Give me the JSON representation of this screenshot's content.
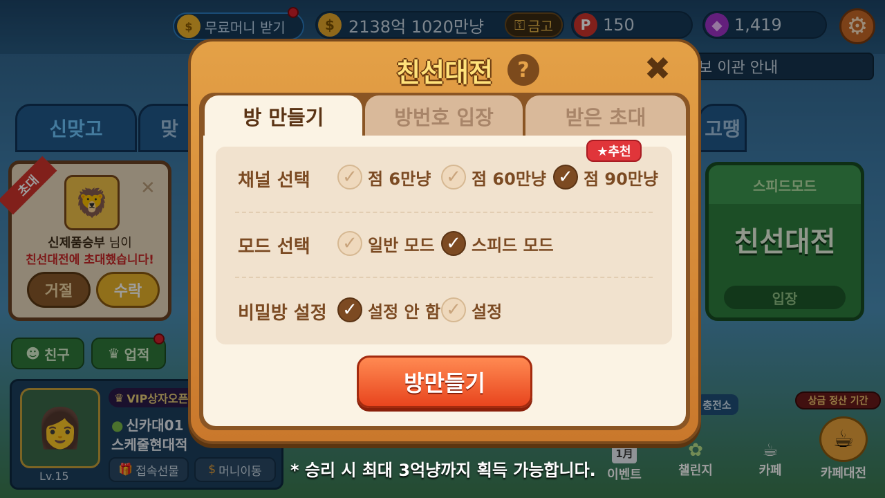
{
  "topbar": {
    "free_money_label": "무료머니 받기",
    "gold_amount": "2138억 1020만냥",
    "vault_label": "금고",
    "points": "150",
    "gems": "1,419"
  },
  "background": {
    "tabs": [
      "신맞고",
      "맞",
      "고땡"
    ],
    "notice_fragment": "보 이관 안내",
    "invite": {
      "ribbon": "초대",
      "inviter": "신제품승부",
      "inviter_suffix": " 님이",
      "message": "친선대전에 초대했습니다!",
      "decline": "거절",
      "accept": "수락"
    },
    "speed_card": {
      "header": "스피드모드",
      "title": "친선대전",
      "enter": "입장"
    },
    "friends": "친구",
    "achievements": "업적",
    "profile": {
      "vip": "VIP상자오픈",
      "name": "신카대01",
      "subtitle": "스케줄현대적",
      "level": "Lv.15",
      "gift": "접속선물",
      "money_move": "머니이동"
    },
    "right_menu": {
      "settle_badge": "상금 정산 기간",
      "charging": "충전소",
      "event": "이벤트",
      "event_icon_text": "1月",
      "challenge": "챌린지",
      "cafe": "카페",
      "cafe_battle": "카페대전"
    }
  },
  "modal": {
    "title": "친선대전",
    "help": "?",
    "tabs": [
      {
        "label": "방 만들기",
        "active": true
      },
      {
        "label": "방번호 입장",
        "active": false
      },
      {
        "label": "받은 초대",
        "active": false
      }
    ],
    "rows": [
      {
        "label": "채널 선택",
        "options": [
          {
            "text": "점 6만냥",
            "checked": false
          },
          {
            "text": "점 60만냥",
            "checked": false
          },
          {
            "text": "점 90만냥",
            "checked": true
          }
        ]
      },
      {
        "label": "모드 선택",
        "options": [
          {
            "text": "일반 모드",
            "checked": false
          },
          {
            "text": "스피드 모드",
            "checked": true
          }
        ]
      },
      {
        "label": "비밀방 설정",
        "options": [
          {
            "text": "설정 안 함",
            "checked": true
          },
          {
            "text": "설정",
            "checked": false
          }
        ]
      }
    ],
    "recommend_badge": "★추천",
    "create_button": "방만들기"
  },
  "footnote": "* 승리 시 최대 3억냥까지 획득 가능합니다.",
  "colors": {
    "modal_frame": "#d98f3c",
    "panel": "#fbf3e4",
    "checked": "#7c4a22",
    "button": "#f05a28"
  }
}
